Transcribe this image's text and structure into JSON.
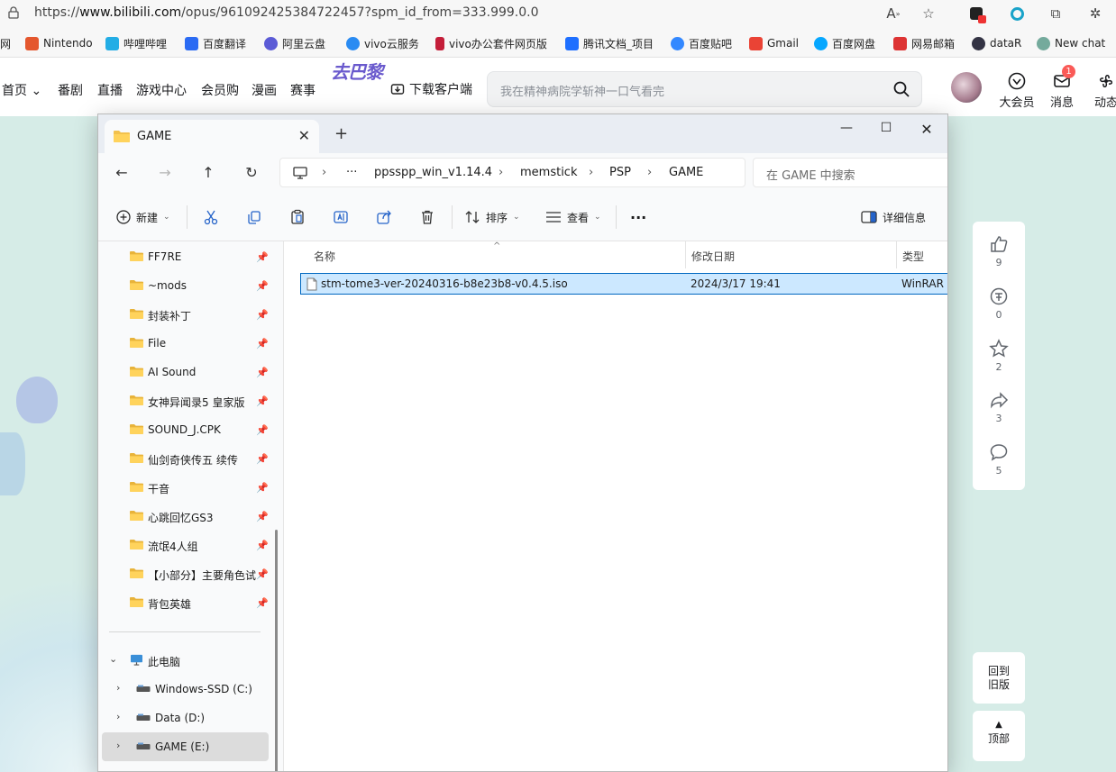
{
  "browser": {
    "url_prefix": "https://",
    "url_host": "www.bilibili.com",
    "url_path": "/opus/961092425384722457?spm_id_from=333.999.0.0",
    "bookmarks": [
      {
        "label": "网",
        "color": "#e44"
      },
      {
        "label": "Nintendo",
        "color": "#e4572e"
      },
      {
        "label": "哔哩哔哩",
        "color": "#23ade5"
      },
      {
        "label": "百度翻译",
        "color": "#2b6bf3"
      },
      {
        "label": "阿里云盘",
        "color": "#5b5bd6"
      },
      {
        "label": "vivo云服务",
        "color": "#2a8bf2"
      },
      {
        "label": "vivo办公套件网页版",
        "color": "#c41e3a"
      },
      {
        "label": "腾讯文档_项目",
        "color": "#1e6fff"
      },
      {
        "label": "百度贴吧",
        "color": "#3388ff"
      },
      {
        "label": "Gmail",
        "color": "#ea4335"
      },
      {
        "label": "百度网盘",
        "color": "#06a7ff"
      },
      {
        "label": "网易邮箱",
        "color": "#d33"
      },
      {
        "label": "dataR",
        "color": "#334"
      },
      {
        "label": "New chat",
        "color": "#74aa9c"
      }
    ]
  },
  "bili": {
    "nav": [
      "首页",
      "番剧",
      "直播",
      "游戏中心",
      "会员购",
      "漫画",
      "赛事"
    ],
    "logo_text": "去巴黎",
    "logo_sub": "去巴黎",
    "download": "下载客户端",
    "search_placeholder": "我在精神病院学斩神一口气看完",
    "vip": "大会员",
    "messages": "消息",
    "messages_badge": "1",
    "dynamic": "动态",
    "side": {
      "like_count": "9",
      "coin_count": "0",
      "fav_count": "2",
      "share_count": "3",
      "comment_count": "5"
    },
    "old_version": "回到旧版",
    "top": "顶部"
  },
  "explorer": {
    "tab_title": "GAME",
    "breadcrumbs": [
      "ppsspp_win_v1.14.4",
      "memstick",
      "PSP",
      "GAME"
    ],
    "search_placeholder": "在 GAME 中搜索",
    "toolbar": {
      "new": "新建",
      "sort": "排序",
      "view": "查看",
      "more": "···",
      "details": "详细信息"
    },
    "quick_access": [
      "FF7RE",
      "~mods",
      "封装补丁",
      "File",
      "AI Sound",
      "女神异闻录5 皇家版",
      "SOUND_J.CPK",
      "仙剑奇侠传五 续传",
      "干音",
      "心跳回忆GS3",
      "流氓4人组",
      "【小部分】主要角色试",
      "背包英雄"
    ],
    "this_pc": "此电脑",
    "drives": [
      "Windows-SSD (C:)",
      "Data (D:)",
      "GAME (E:)"
    ],
    "columns": {
      "name": "名称",
      "modified": "修改日期",
      "type": "类型"
    },
    "files": [
      {
        "name": "stm-tome3-ver-20240316-b8e23b8-v0.4.5.iso",
        "modified": "2024/3/17 19:41",
        "type": "WinRAR"
      }
    ]
  }
}
